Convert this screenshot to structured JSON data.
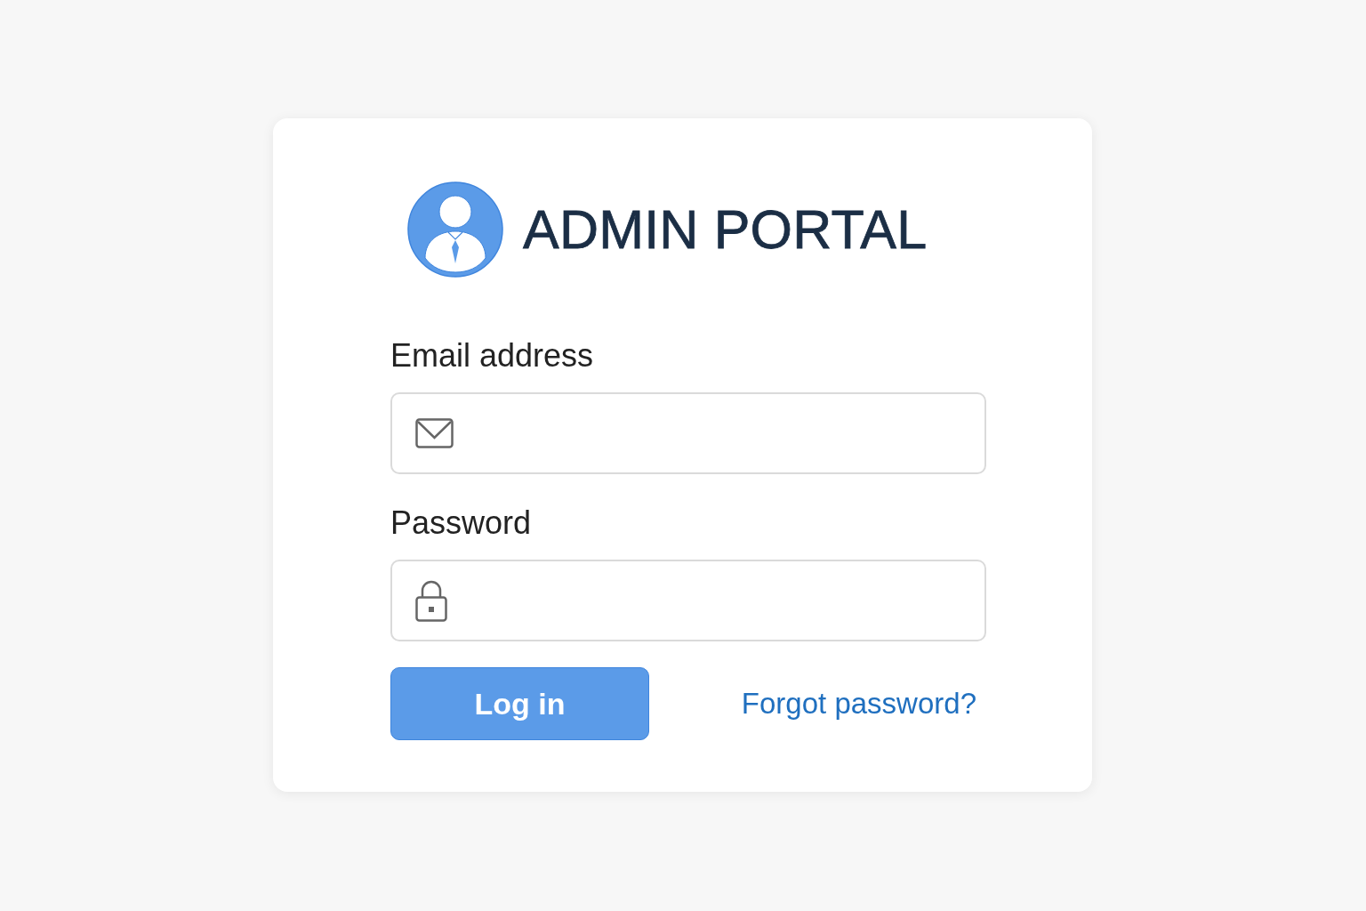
{
  "header": {
    "title": "ADMIN PORTAL"
  },
  "fields": [
    {
      "kind": "email",
      "label": "Email address"
    },
    {
      "kind": "password",
      "label": "Password"
    }
  ],
  "actions": {
    "login_button": "Log in",
    "forgot_link": "Forgot password?"
  }
}
